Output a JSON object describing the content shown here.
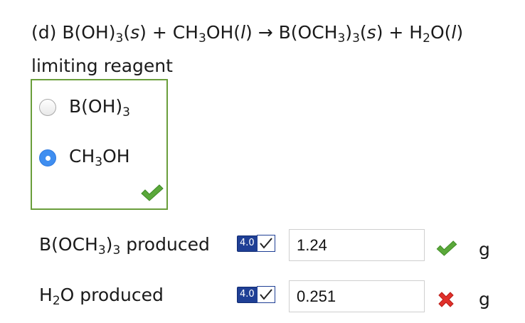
{
  "question": {
    "part": "(d)",
    "r1": "B(OH)",
    "r1_sub": "3",
    "r1_state": "s",
    "plus": "+",
    "r2a": "CH",
    "r2_sub": "3",
    "r2b": "OH",
    "r2_state": "l",
    "arrow": "→",
    "p1a": "B(OCH",
    "p1_sub1": "3",
    "p1b": ")",
    "p1_sub2": "3",
    "p1_state": "s",
    "p2a": "H",
    "p2_sub": "2",
    "p2b": "O",
    "p2_state": "l"
  },
  "limiting_label": "limiting reagent",
  "choices": [
    {
      "a": "B(OH)",
      "sub": "3",
      "b": "",
      "selected": false
    },
    {
      "a": "CH",
      "sub": "3",
      "b": "OH",
      "selected": true
    }
  ],
  "choice_status_icon": "check-icon",
  "rows": [
    {
      "label_a": "B(OCH",
      "label_sub1": "3",
      "label_b": ")",
      "label_sub2": "3",
      "label_c": " produced",
      "sig_figs": "4.0",
      "value": "1.24",
      "status_icon": "check-icon",
      "unit": "g"
    },
    {
      "label_a": "H",
      "label_sub1": "2",
      "label_b": "O produced",
      "sig_figs": "4.0",
      "value": "0.251",
      "status_icon": "x-icon",
      "unit": "g"
    }
  ],
  "colors": {
    "correct": "#5aa83a",
    "incorrect": "#e0302b",
    "box_border": "#6a9e3b",
    "radio_selected": "#3f8ef0",
    "badge": "#1f3f95"
  }
}
